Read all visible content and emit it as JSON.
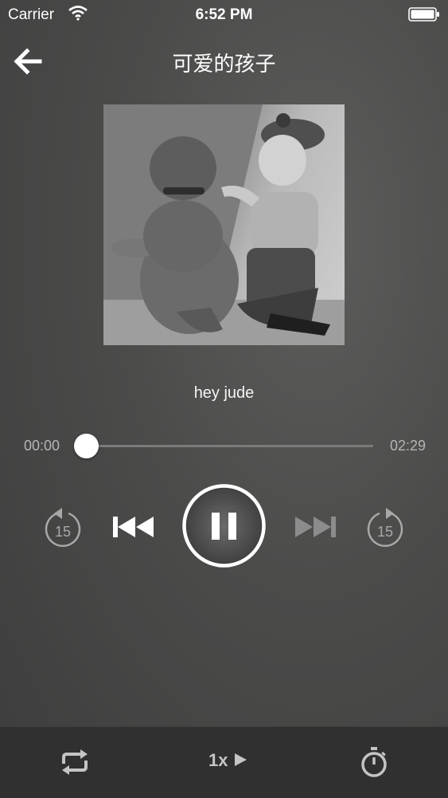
{
  "status_bar": {
    "carrier": "Carrier",
    "time": "6:52 PM"
  },
  "nav": {
    "title": "可爱的孩子",
    "back_icon": "arrow-left-icon"
  },
  "track": {
    "name": "hey jude",
    "elapsed": "00:00",
    "duration": "02:29",
    "progress": 0.0
  },
  "controls": {
    "rewind_label": "15",
    "forward_label": "15",
    "icons": [
      "rewind-15-icon",
      "skip-previous-icon",
      "pause-icon",
      "skip-next-icon",
      "forward-15-icon"
    ]
  },
  "bottom_bar": {
    "speed_label": "1x",
    "icons": [
      "repeat-icon",
      "play-speed-icon",
      "timer-icon"
    ]
  },
  "colors": {
    "background": "#4b4b4a",
    "bottom_bar": "#303030",
    "accent": "#ffffff",
    "muted": "#b4b4b4"
  }
}
